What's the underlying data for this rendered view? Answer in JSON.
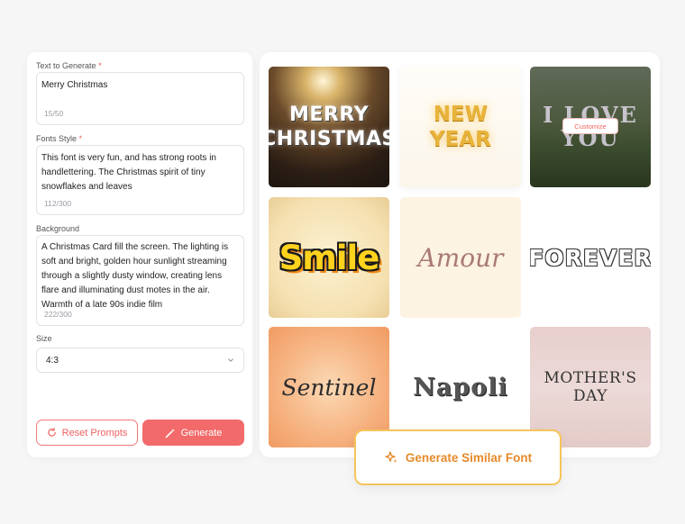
{
  "form": {
    "text_label": "Text to Generate",
    "text_value": "Merry Christmas",
    "text_count": "15/50",
    "style_label": "Fonts Style",
    "style_value": "This font is very fun, and has strong roots in handlettering. The Christmas spirit of tiny snowflakes and leaves",
    "style_count": "112/300",
    "bg_label": "Background",
    "bg_value": "A Christmas Card fill the screen. The lighting is soft and bright, golden hour sunlight streaming through a slightly dusty window, creating lens flare and illuminating dust motes in the air. Warmth of a late 90s indie film",
    "bg_count": "222/300",
    "size_label": "Size",
    "size_value": "4:3",
    "required_mark": "*",
    "reset_label": "Reset Prompts",
    "generate_label": "Generate"
  },
  "gallery": {
    "tiles": [
      {
        "text": "MERRY\nCHRISTMAS"
      },
      {
        "text": "NEW\nYEAR"
      },
      {
        "text": "I LOVE\nYOU"
      },
      {
        "text": "Smile"
      },
      {
        "text": "Amour"
      },
      {
        "text": "FOREVER"
      },
      {
        "text": "Sentinel"
      },
      {
        "text": "Napoli"
      },
      {
        "text": "MOTHER'S DAY"
      }
    ],
    "customize_label": "Customize"
  },
  "cta": {
    "label": "Generate Similar Font"
  },
  "colors": {
    "accent": "#f26a6a",
    "cta_border": "#f6c45a",
    "cta_text": "#e58a2a"
  }
}
